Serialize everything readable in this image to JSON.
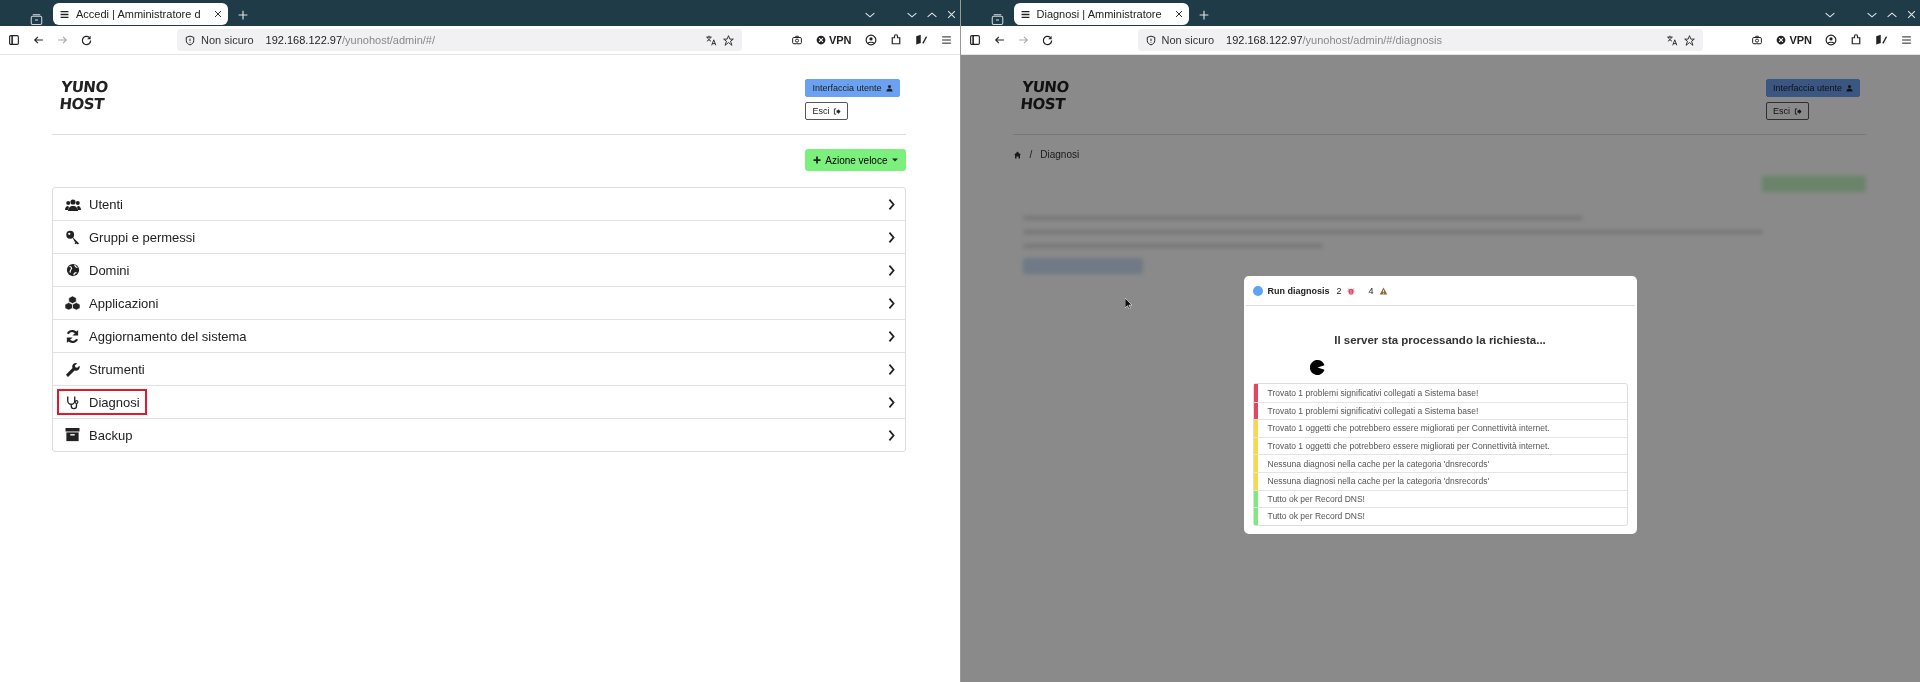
{
  "left_window": {
    "tab": {
      "title": "Accedi | Amministratore d"
    },
    "address": {
      "security": "Non sicuro",
      "host": "192.168.122.97",
      "path": "/yunohost/admin/#/"
    },
    "vpn": "VPN",
    "logo": [
      "YUNO",
      "HOST"
    ],
    "header_buttons": [
      {
        "label": "Interfaccia utente",
        "kind": "primary"
      },
      {
        "label": "Esci",
        "kind": "outline"
      }
    ],
    "quick_action": "Azione veloce",
    "menu": [
      {
        "label": "Utenti",
        "highlighted": false
      },
      {
        "label": "Gruppi e permessi",
        "highlighted": false
      },
      {
        "label": "Domini",
        "highlighted": false
      },
      {
        "label": "Applicazioni",
        "highlighted": false
      },
      {
        "label": "Aggiornamento del sistema",
        "highlighted": false
      },
      {
        "label": "Strumenti",
        "highlighted": false
      },
      {
        "label": "Diagnosi",
        "highlighted": true
      },
      {
        "label": "Backup",
        "highlighted": false
      }
    ]
  },
  "right_window": {
    "tab": {
      "title": "Diagnosi | Amministratore"
    },
    "address": {
      "security": "Non sicuro",
      "host": "192.168.122.97",
      "path": "/yunohost/admin/#/diagnosis"
    },
    "vpn": "VPN",
    "logo": [
      "YUNO",
      "HOST"
    ],
    "header_buttons": [
      {
        "label": "Interfaccia utente",
        "kind": "primary"
      },
      {
        "label": "Esci",
        "kind": "outline"
      }
    ],
    "breadcrumb": {
      "separator": "/",
      "current": "Diagnosi"
    },
    "modal": {
      "title": "Run diagnosis",
      "error_count": "2",
      "warning_count": "4",
      "message": "Il server sta processando la richiesta...",
      "log": [
        {
          "text": "Trovato 1 problemi significativi collegati a Sistema base!",
          "color": "#e3475f"
        },
        {
          "text": "Trovato 1 problemi significativi collegati a Sistema base!",
          "color": "#e3475f"
        },
        {
          "text": "Trovato 1 oggetti che potrebbero essere migliorati per Connettività internet.",
          "color": "#f7d84a"
        },
        {
          "text": "Trovato 1 oggetti che potrebbero essere migliorati per Connettività internet.",
          "color": "#f7d84a"
        },
        {
          "text": "Nessuna diagnosi nella cache per la categoria 'dnsrecords'",
          "color": "#f7d84a"
        },
        {
          "text": "Nessuna diagnosi nella cache per la categoria 'dnsrecords'",
          "color": "#f7d84a"
        },
        {
          "text": "Tutto ok per Record DNS!",
          "color": "#7ceb7c"
        },
        {
          "text": "Tutto ok per Record DNS!",
          "color": "#7ceb7c"
        }
      ]
    }
  }
}
